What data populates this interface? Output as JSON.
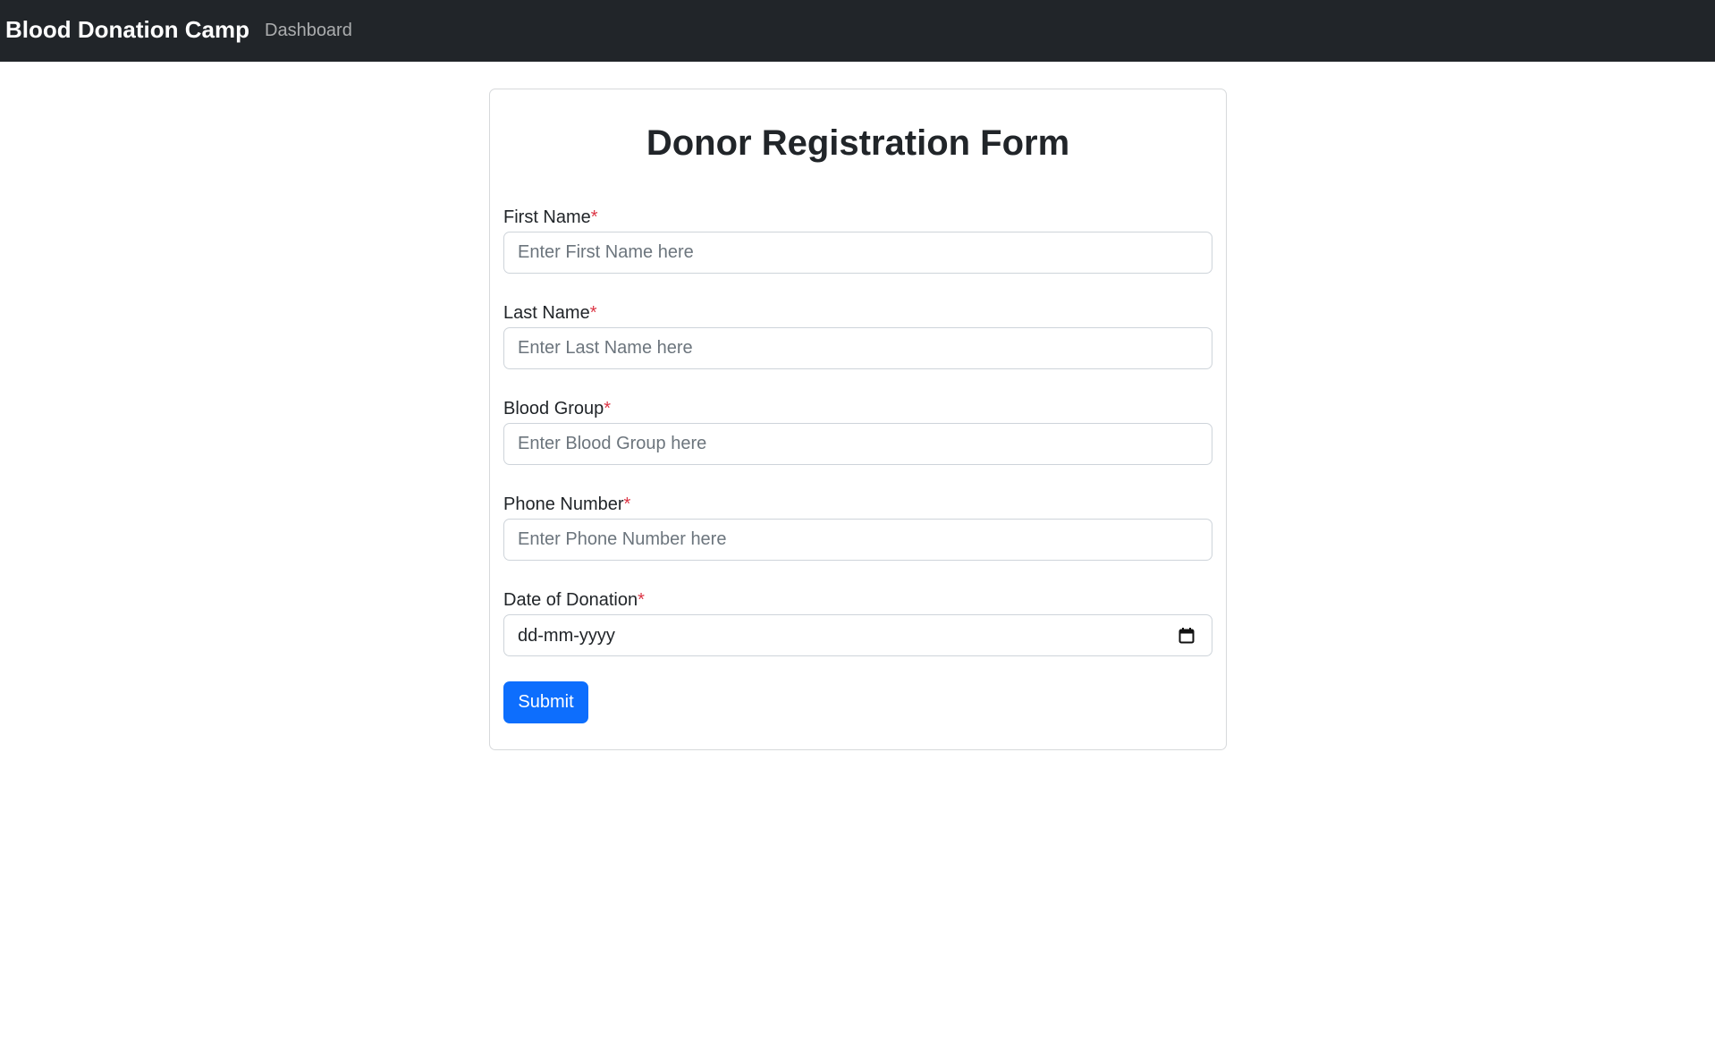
{
  "navbar": {
    "brand": "Blood Donation Camp",
    "links": [
      "Dashboard"
    ]
  },
  "form": {
    "title": "Donor Registration Form",
    "required_marker": "*",
    "fields": [
      {
        "label": "First Name",
        "placeholder": "Enter First Name here"
      },
      {
        "label": "Last Name",
        "placeholder": "Enter Last Name here"
      },
      {
        "label": "Blood Group",
        "placeholder": "Enter Blood Group here"
      },
      {
        "label": "Phone Number",
        "placeholder": "Enter Phone Number here"
      },
      {
        "label": "Date of Donation",
        "placeholder": "dd-mm-yyyy",
        "icon": "calendar-icon"
      }
    ],
    "submit_label": "Submit"
  },
  "colors": {
    "navbar_bg": "#212529",
    "primary": "#0d6efd",
    "required": "#dc3545"
  }
}
